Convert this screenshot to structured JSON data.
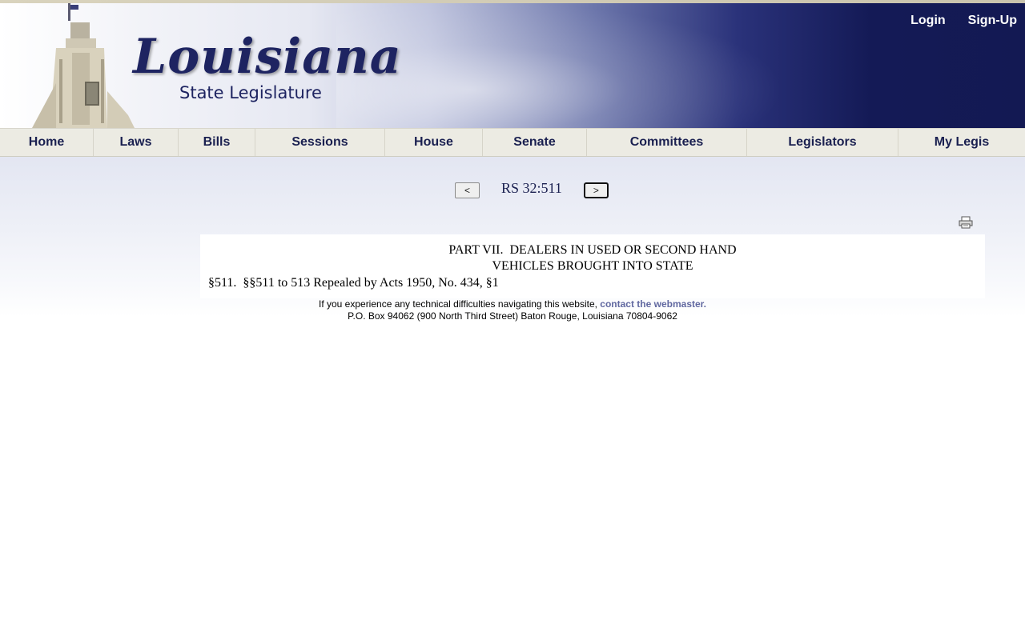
{
  "header": {
    "logo_title": "Louisiana",
    "logo_subtitle": "State Legislature",
    "login_label": "Login",
    "signup_label": "Sign-Up"
  },
  "nav": {
    "items": [
      "Home",
      "Laws",
      "Bills",
      "Sessions",
      "House",
      "Senate",
      "Committees",
      "Legislators",
      "My Legis"
    ]
  },
  "pager": {
    "prev_label": "<",
    "title": "RS 32:511",
    "next_label": ">"
  },
  "icons": {
    "print": "printer-icon"
  },
  "law": {
    "heading_line1": "PART VII.  DEALERS IN USED OR SECOND HAND",
    "heading_line2": "VEHICLES BROUGHT INTO STATE",
    "text": "§511.  §§511 to 513 Repealed by Acts 1950, No. 434, §1"
  },
  "footer": {
    "help_text": "If you experience any technical difficulties navigating this website, ",
    "contact_link": "contact the webmaster.",
    "address": "P.O. Box 94062 (900 North Third Street) Baton Rouge, Louisiana 70804-9062"
  },
  "colors": {
    "brand_navy": "#1e2461",
    "banner_dark": "#131953",
    "nav_bg": "#ecebe3",
    "link": "#6168a0"
  }
}
